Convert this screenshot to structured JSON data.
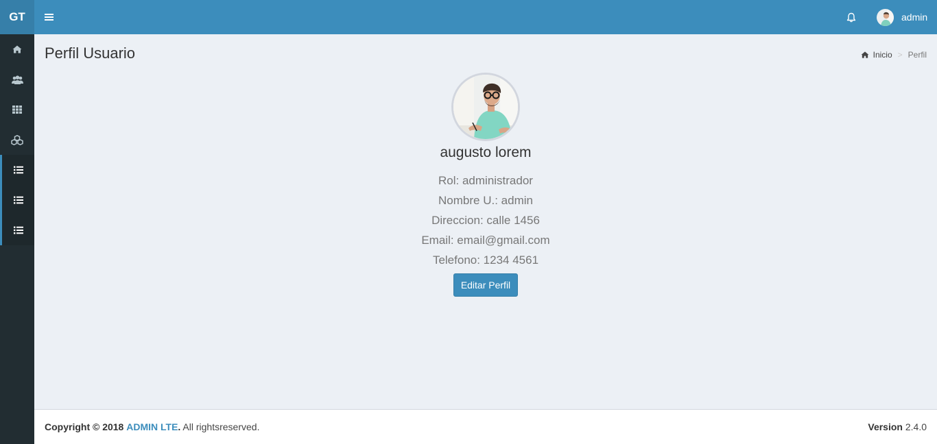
{
  "brand": {
    "logo_text": "GT",
    "accent": "#3c8dbc",
    "sidebar_bg": "#222d32"
  },
  "header": {
    "menu_icon": "hamburger-icon",
    "notification_icon": "bell-icon",
    "user_name": "admin"
  },
  "sidebar": {
    "items": [
      {
        "icon": "home-icon"
      },
      {
        "icon": "users-icon"
      },
      {
        "icon": "grid-icon"
      },
      {
        "icon": "cubes-icon"
      },
      {
        "icon": "list-icon"
      },
      {
        "icon": "list-icon"
      },
      {
        "icon": "list-icon"
      }
    ]
  },
  "page": {
    "title": "Perfil Usuario",
    "breadcrumb": {
      "home": "Inicio",
      "current": "Perfil"
    }
  },
  "profile": {
    "name": "augusto lorem",
    "rol": "Rol: administrador",
    "username": "Nombre U.: admin",
    "address": "Direccion: calle 1456",
    "email": "Email: email@gmail.com",
    "phone": "Telefono: 1234 4561",
    "edit_label": "Editar Perfil"
  },
  "footer": {
    "copyright": "Copyright © 2018",
    "brand_link": "ADMIN LTE",
    "rights": ". All rightsreserved.",
    "version_label": "Version",
    "version": "2.4.0"
  }
}
